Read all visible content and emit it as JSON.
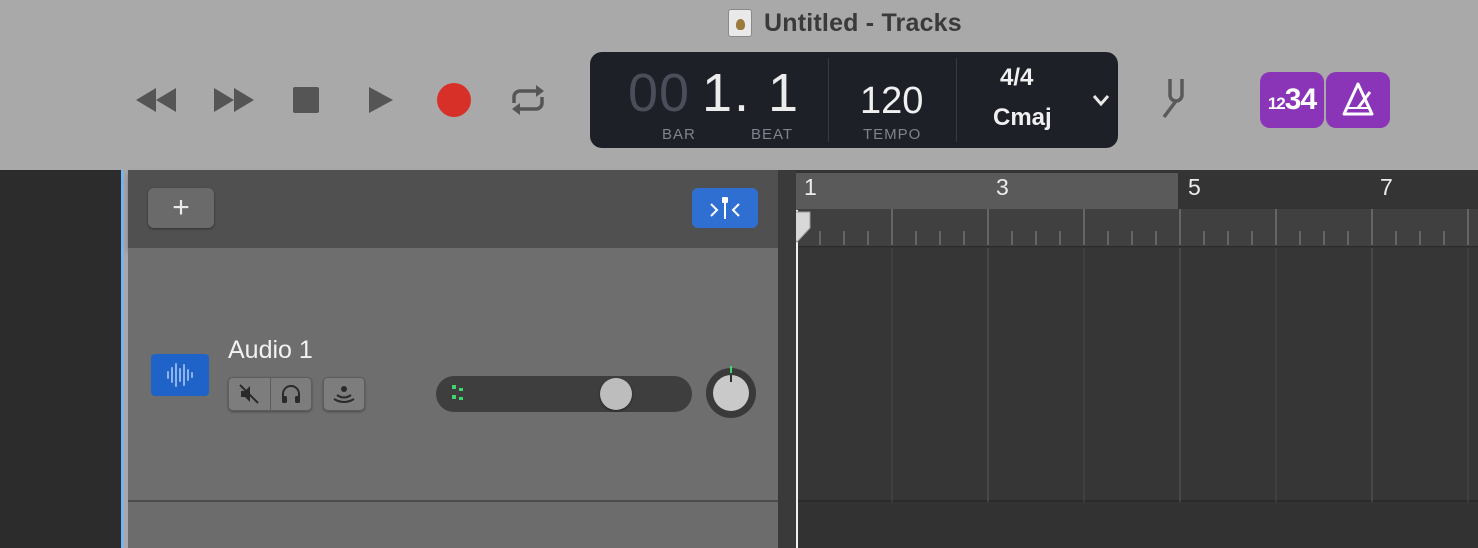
{
  "window": {
    "title": "Untitled - Tracks",
    "doc_icon": "garageband-document-icon"
  },
  "transport": {
    "rewind": "rewind-icon",
    "fast_forward": "fast-forward-icon",
    "stop": "stop-icon",
    "play": "play-icon",
    "record": "record-icon",
    "cycle": "cycle-icon",
    "record_color": "#d63029"
  },
  "lcd": {
    "position_dim": "00",
    "position_value": "1. 1",
    "bar_label": "BAR",
    "beat_label": "BEAT",
    "tempo": "120",
    "tempo_label": "TEMPO",
    "time_signature": "4/4",
    "key": "Cmaj"
  },
  "toolbar": {
    "tuner": "tuner-fork-icon",
    "count_in_big": "34",
    "count_in_small": "12",
    "metronome": "metronome-icon",
    "accent_color": "#8a35b8"
  },
  "track_header": {
    "add_label": "+",
    "filter_icon": "catch-playhead-icon"
  },
  "tracks": [
    {
      "name": "Audio 1",
      "type_icon": "audio-waveform-icon",
      "mute_icon": "mute-speaker-icon",
      "solo_icon": "headphones-icon",
      "monitor_icon": "input-monitor-icon",
      "volume_fraction": 0.74,
      "pan": 0
    }
  ],
  "ruler": {
    "bars": [
      "1",
      "3",
      "5",
      "7"
    ]
  }
}
